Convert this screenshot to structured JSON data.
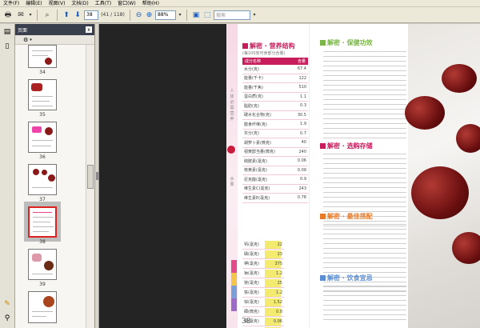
{
  "menu": [
    "文件(F)",
    "编辑(E)",
    "视图(V)",
    "文档(D)",
    "工具(T)",
    "窗口(W)",
    "帮助(H)"
  ],
  "toolbar": {
    "page_current": "38",
    "page_total": "(41 / 118)",
    "zoom": "88%",
    "search_placeholder": "搜索"
  },
  "panel": {
    "title": "页面",
    "close": "x"
  },
  "thumbnails": [
    {
      "label": "34"
    },
    {
      "label": "35"
    },
    {
      "label": "36"
    },
    {
      "label": "37"
    },
    {
      "label": "38",
      "selected": true
    },
    {
      "label": "39"
    }
  ],
  "document": {
    "left_page_number": "38",
    "section1_title": "解密 · 营养结构",
    "section1_sub": "(每100克可食部分含量)",
    "table_header": {
      "name": "成分名称",
      "amount": "含量"
    },
    "nutrition": [
      {
        "name": "水分(克)",
        "value": "67.4"
      },
      {
        "name": "能量(千卡)",
        "value": "122"
      },
      {
        "name": "能量(千焦)",
        "value": "510"
      },
      {
        "name": "蛋白质(克)",
        "value": "1.1"
      },
      {
        "name": "脂肪(克)",
        "value": "0.3"
      },
      {
        "name": "碳水化合物(克)",
        "value": "30.5"
      },
      {
        "name": "膳食纤维(克)",
        "value": "1.9"
      },
      {
        "name": "灰分(克)",
        "value": "0.7"
      },
      {
        "name": "胡萝卜素(微克)",
        "value": "40"
      },
      {
        "name": "视黄醇当量(微克)",
        "value": "240"
      },
      {
        "name": "硫胺素(毫克)",
        "value": "0.06"
      },
      {
        "name": "核黄素(毫克)",
        "value": "0.09"
      },
      {
        "name": "尼克酸(毫克)",
        "value": "0.9"
      },
      {
        "name": "维生素C(毫克)",
        "value": "243"
      },
      {
        "name": "维生素E(毫克)",
        "value": "0.78"
      }
    ],
    "minerals": [
      {
        "name": "钙(毫克)",
        "value": "22"
      },
      {
        "name": "磷(毫克)",
        "value": "23"
      },
      {
        "name": "钾(毫克)",
        "value": "375"
      },
      {
        "name": "钠(毫克)",
        "value": "1.2"
      },
      {
        "name": "镁(毫克)",
        "value": "25"
      },
      {
        "name": "铁(毫克)",
        "value": "1.2"
      },
      {
        "name": "锌(毫克)",
        "value": "1.52"
      },
      {
        "name": "硒(微克)",
        "value": "0.8"
      },
      {
        "name": "铜(毫克)",
        "value": "0.06"
      },
      {
        "name": "锰(毫克)",
        "value": "0.32"
      }
    ],
    "r_sec1": "解密 · 保健功效",
    "r_sec2": "解密 · 选购存储",
    "r_sec3": "解密 · 最佳搭配",
    "r_sec4": "解密 · 饮食宜忌"
  }
}
